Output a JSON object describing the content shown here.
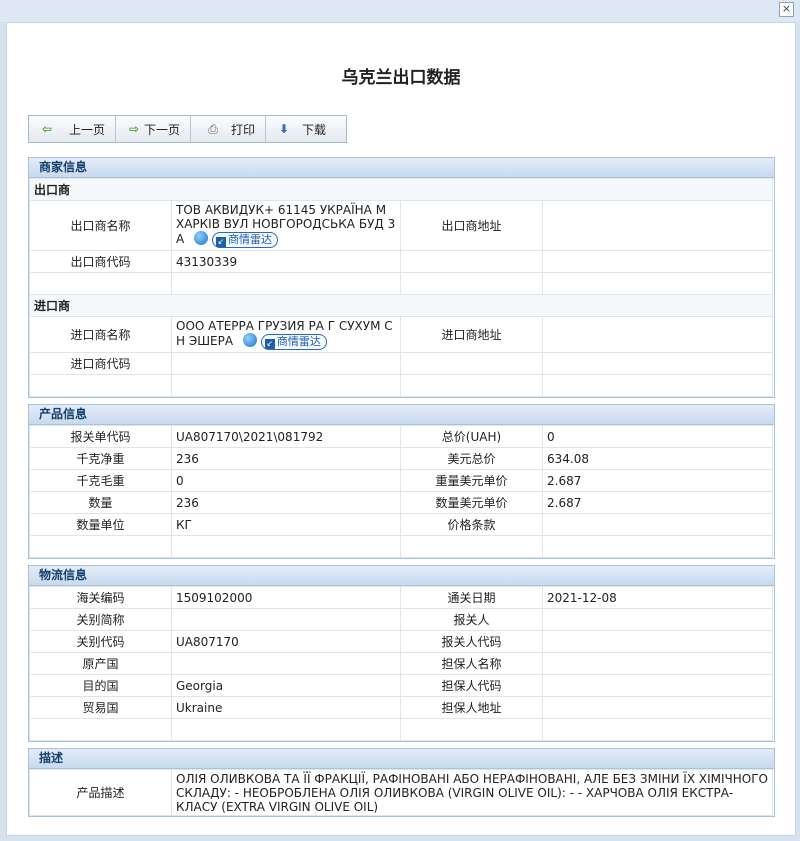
{
  "window": {
    "close_glyph": "×"
  },
  "page_title": "乌克兰出口数据",
  "toolbar": {
    "prev_label": "上一页",
    "next_label": "下一页",
    "print_label": "打印",
    "download_label": "下载"
  },
  "merchant": {
    "section_title": "商家信息",
    "exporter_heading": "出口商",
    "exporter_name_label": "出口商名称",
    "exporter_name": "ТОВ АКВИДУК+ 61145 УКРАЇНА М ХАРКІВ ВУЛ НОВГОРОДСЬКА БУД 3 А",
    "exporter_addr_label": "出口商地址",
    "exporter_addr": "",
    "exporter_code_label": "出口商代码",
    "exporter_code": "43130339",
    "radar_label": "商情雷达",
    "importer_heading": "进口商",
    "importer_name_label": "进口商名称",
    "importer_name": "ООО АТЕРРА ГРУЗИЯ РА Г СУХУМ С Н ЭШЕРА",
    "importer_addr_label": "进口商地址",
    "importer_addr": "",
    "importer_code_label": "进口商代码",
    "importer_code": ""
  },
  "product": {
    "section_title": "产品信息",
    "rows": [
      {
        "l1": "报关单代码",
        "v1": "UA807170\\2021\\081792",
        "l2": "总价(UAH)",
        "v2": "0"
      },
      {
        "l1": "千克净重",
        "v1": "236",
        "l2": "美元总价",
        "v2": "634.08"
      },
      {
        "l1": "千克毛重",
        "v1": "0",
        "l2": "重量美元单价",
        "v2": "2.687"
      },
      {
        "l1": "数量",
        "v1": "236",
        "l2": "数量美元单价",
        "v2": "2.687"
      },
      {
        "l1": "数量单位",
        "v1": "КГ",
        "l2": "价格条款",
        "v2": ""
      }
    ]
  },
  "logistics": {
    "section_title": "物流信息",
    "rows": [
      {
        "l1": "海关编码",
        "v1": "1509102000",
        "l2": "通关日期",
        "v2": "2021-12-08"
      },
      {
        "l1": "关别简称",
        "v1": "",
        "l2": "报关人",
        "v2": ""
      },
      {
        "l1": "关别代码",
        "v1": "UA807170",
        "l2": "报关人代码",
        "v2": ""
      },
      {
        "l1": "原产国",
        "v1": "",
        "l2": "担保人名称",
        "v2": ""
      },
      {
        "l1": "目的国",
        "v1": "Georgia",
        "l2": "担保人代码",
        "v2": ""
      },
      {
        "l1": "贸易国",
        "v1": "Ukraine",
        "l2": "担保人地址",
        "v2": ""
      }
    ]
  },
  "description": {
    "section_title": "描述",
    "label": "产品描述",
    "text": "ОЛІЯ ОЛИВКОВА ТА ЇЇ ФРАКЦІЇ, РАФІНОВАНІ АБО НЕРАФІНОВАНІ, АЛЕ БЕЗ ЗМІНИ ЇХ ХІМІЧНОГО СКЛАДУ: - НЕОБРОБЛЕНА ОЛІЯ ОЛИВКОВА (VIRGIN OLIVE OIL): - - ХАРЧОВА ОЛІЯ ЕКСТРА-КЛАСУ (EXTRA VIRGIN OLIVE OIL)"
  }
}
